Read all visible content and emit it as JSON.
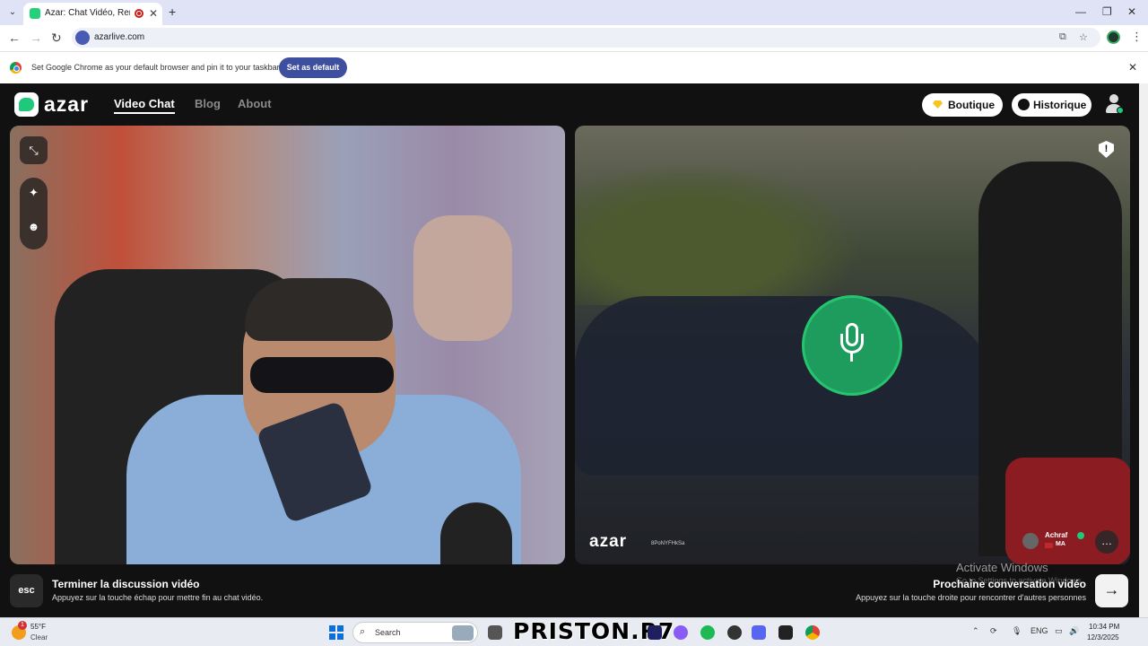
{
  "browser": {
    "tab_title": "Azar: Chat Vidéo, Rencontre",
    "url": "azarlive.com",
    "infobar_text": "Set Google Chrome as your default browser and pin it to your taskbar",
    "set_default_label": "Set as default"
  },
  "azar": {
    "logo": "azar",
    "nav": [
      "Video Chat",
      "Blog",
      "About"
    ],
    "boutique_label": "Boutique",
    "historique_label": "Historique",
    "watermark_logo": "azar",
    "watermark_id": "8PoNYFHkSa",
    "partner": {
      "name": "Achraf",
      "country": "MA"
    },
    "end_title": "Terminer la discussion vidéo",
    "end_sub": "Appuyez sur la touche échap pour mettre fin au chat vidéo.",
    "esc_label": "esc",
    "next_title": "Prochaine conversation vidéo",
    "next_sub": "Appuyez sur la touche droite pour rencontrer d'autres personnes",
    "accent_color": "#1ec97a"
  },
  "windows": {
    "activate_title": "Activate Windows",
    "activate_sub": "Go to Settings to activate Windows."
  },
  "taskbar": {
    "temp": "55°F",
    "condition": "Clear",
    "weather_badge": "1",
    "search_placeholder": "Search",
    "watermark": "PRISTON.R7",
    "language": "ENG",
    "time": "10:34 PM",
    "date": "12/3/2025"
  }
}
